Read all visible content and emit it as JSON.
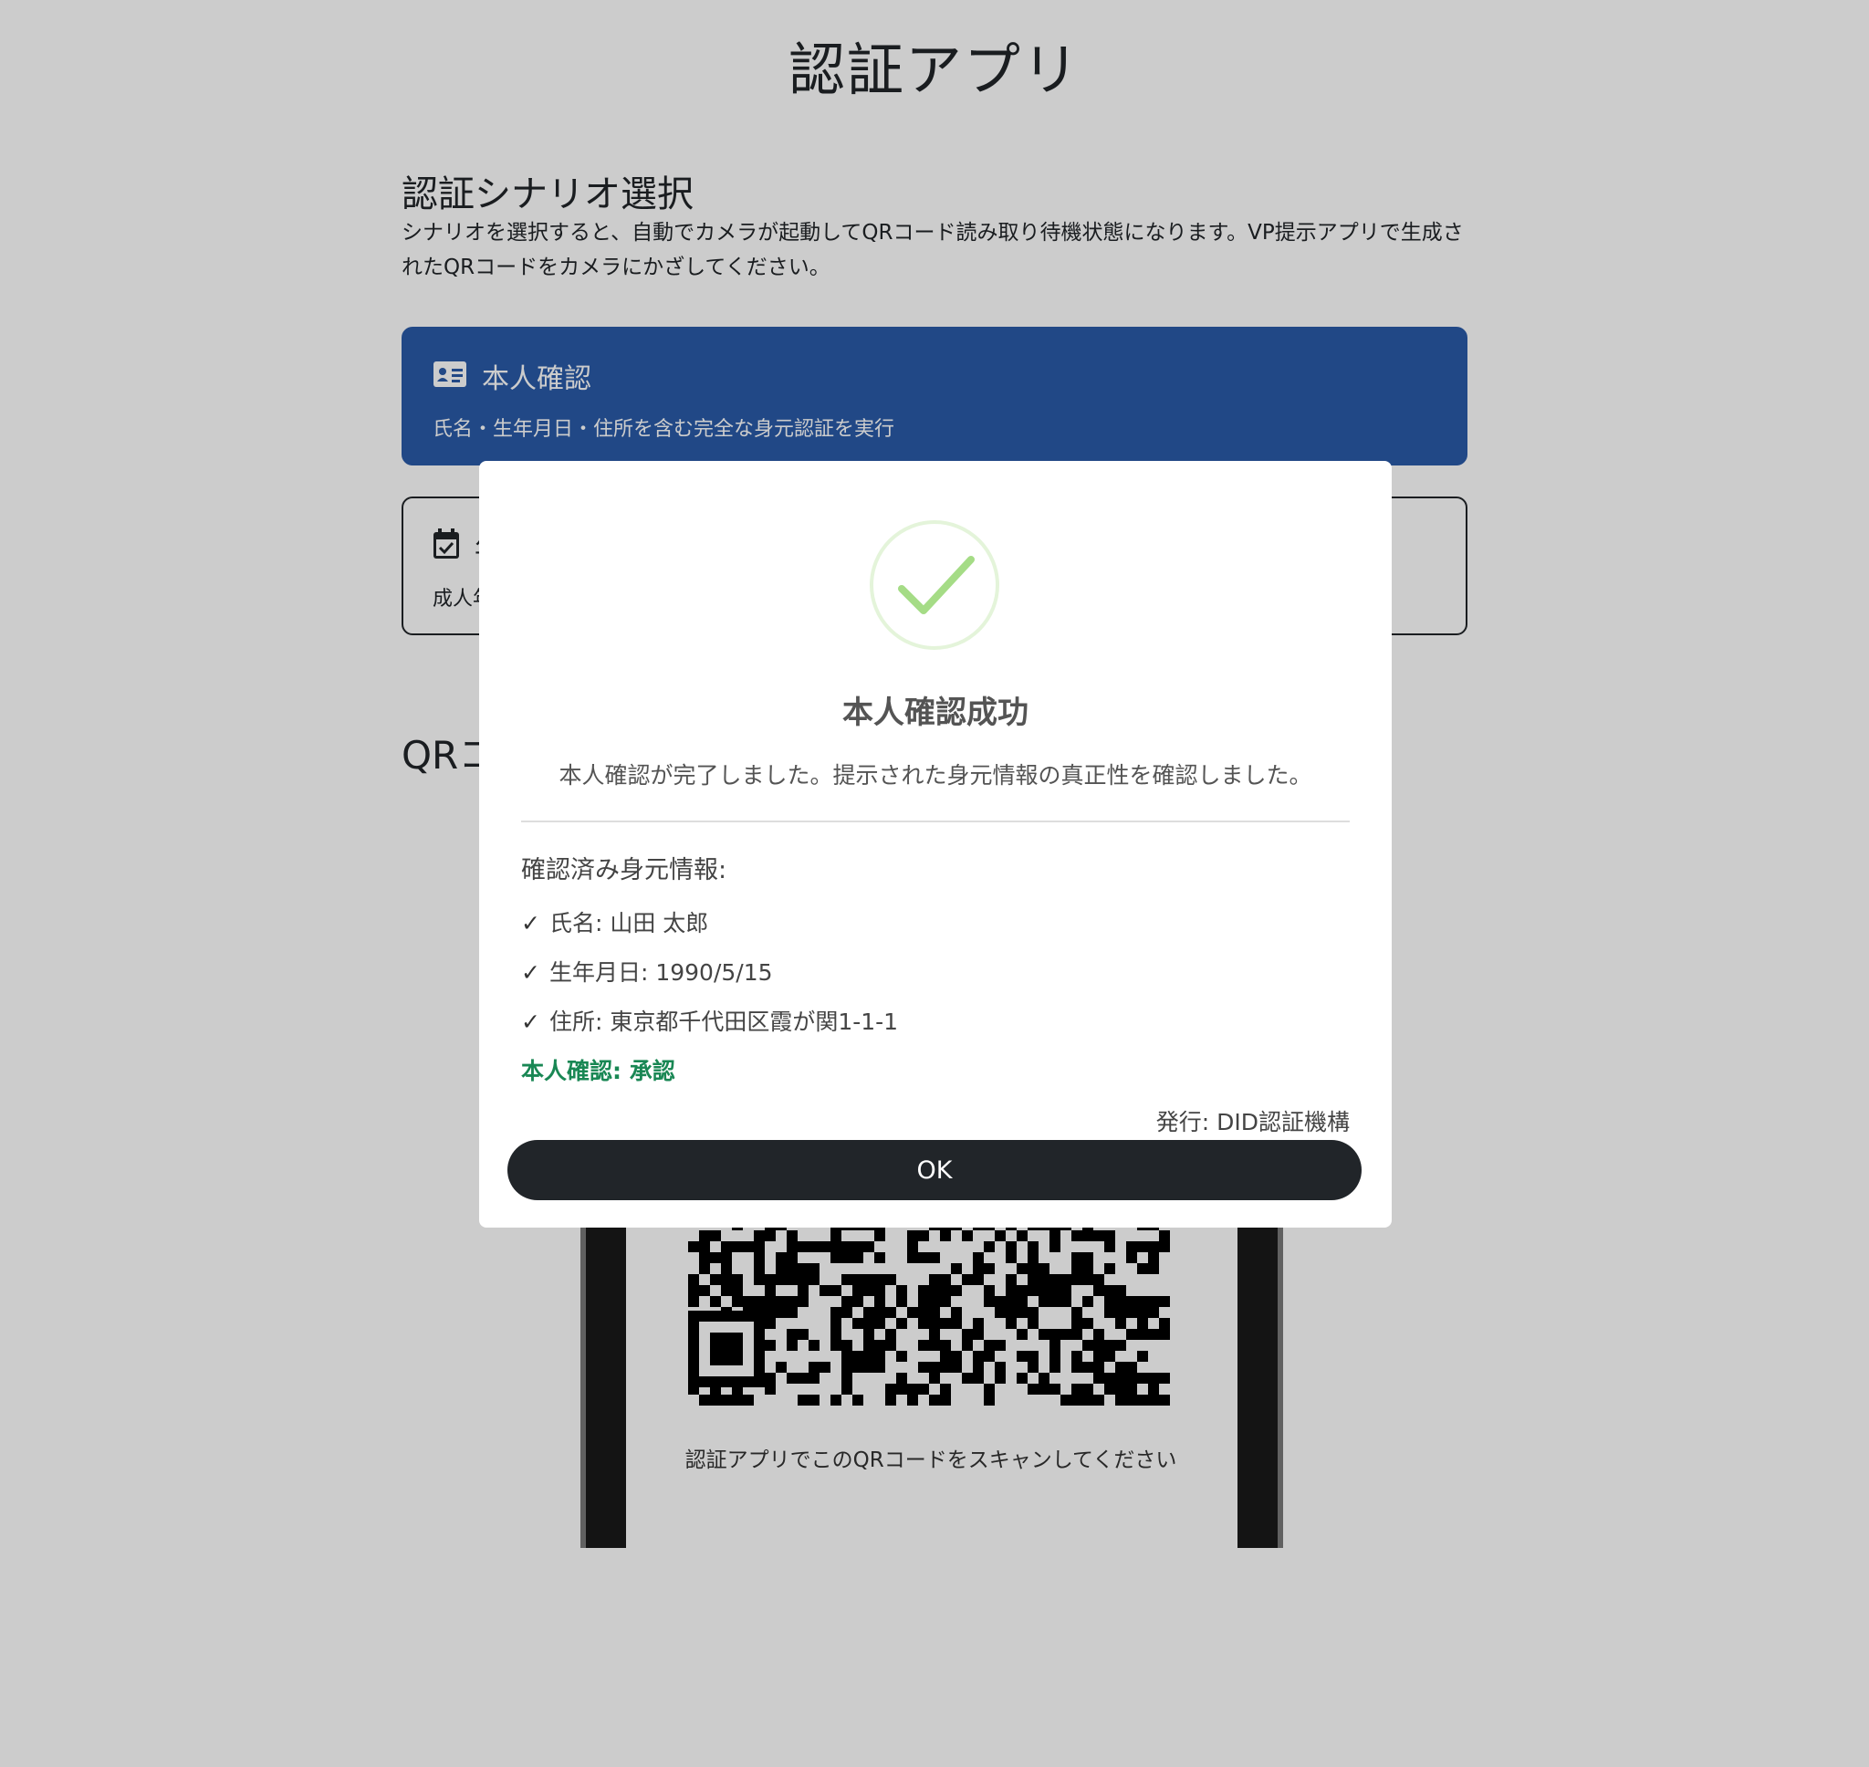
{
  "header": {
    "title": "認証アプリ"
  },
  "scenario": {
    "title": "認証シナリオ選択",
    "description": "シナリオを選択すると、自動でカメラが起動してQRコード読み取り待機状態になります。VP提示アプリで生成されたQRコードをカメラにかざしてください。",
    "cards": [
      {
        "icon": "id-card-icon",
        "title": "本人確認",
        "description": "氏名・生年月日・住所を含む完全な身元認証を実行",
        "selected": true
      },
      {
        "icon": "calendar-check-icon",
        "title": "年",
        "description": "成人年",
        "selected": false
      }
    ]
  },
  "qr_section": {
    "heading": "QRコ",
    "caption": "認証アプリでこのQRコードをスキャンしてください"
  },
  "modal": {
    "icon": "success-check-icon",
    "title": "本人確認成功",
    "message": "本人確認が完了しました。提示された身元情報の真正性を確認しました。",
    "info_heading": "確認済み身元情報:",
    "items": [
      {
        "check": "✓",
        "label": "氏名: 山田 太郎"
      },
      {
        "check": "✓",
        "label": "生年月日: 1990/5/15"
      },
      {
        "check": "✓",
        "label": "住所: 東京都千代田区霞が関1-1-1"
      }
    ],
    "status": "本人確認: 承認",
    "issuer": "発行: DID認証機構",
    "ok_label": "OK"
  },
  "colors": {
    "primary": "#2a5aa8",
    "success_green": "#198754",
    "check_light_green": "#a5dc86",
    "button_dark": "#212529"
  }
}
